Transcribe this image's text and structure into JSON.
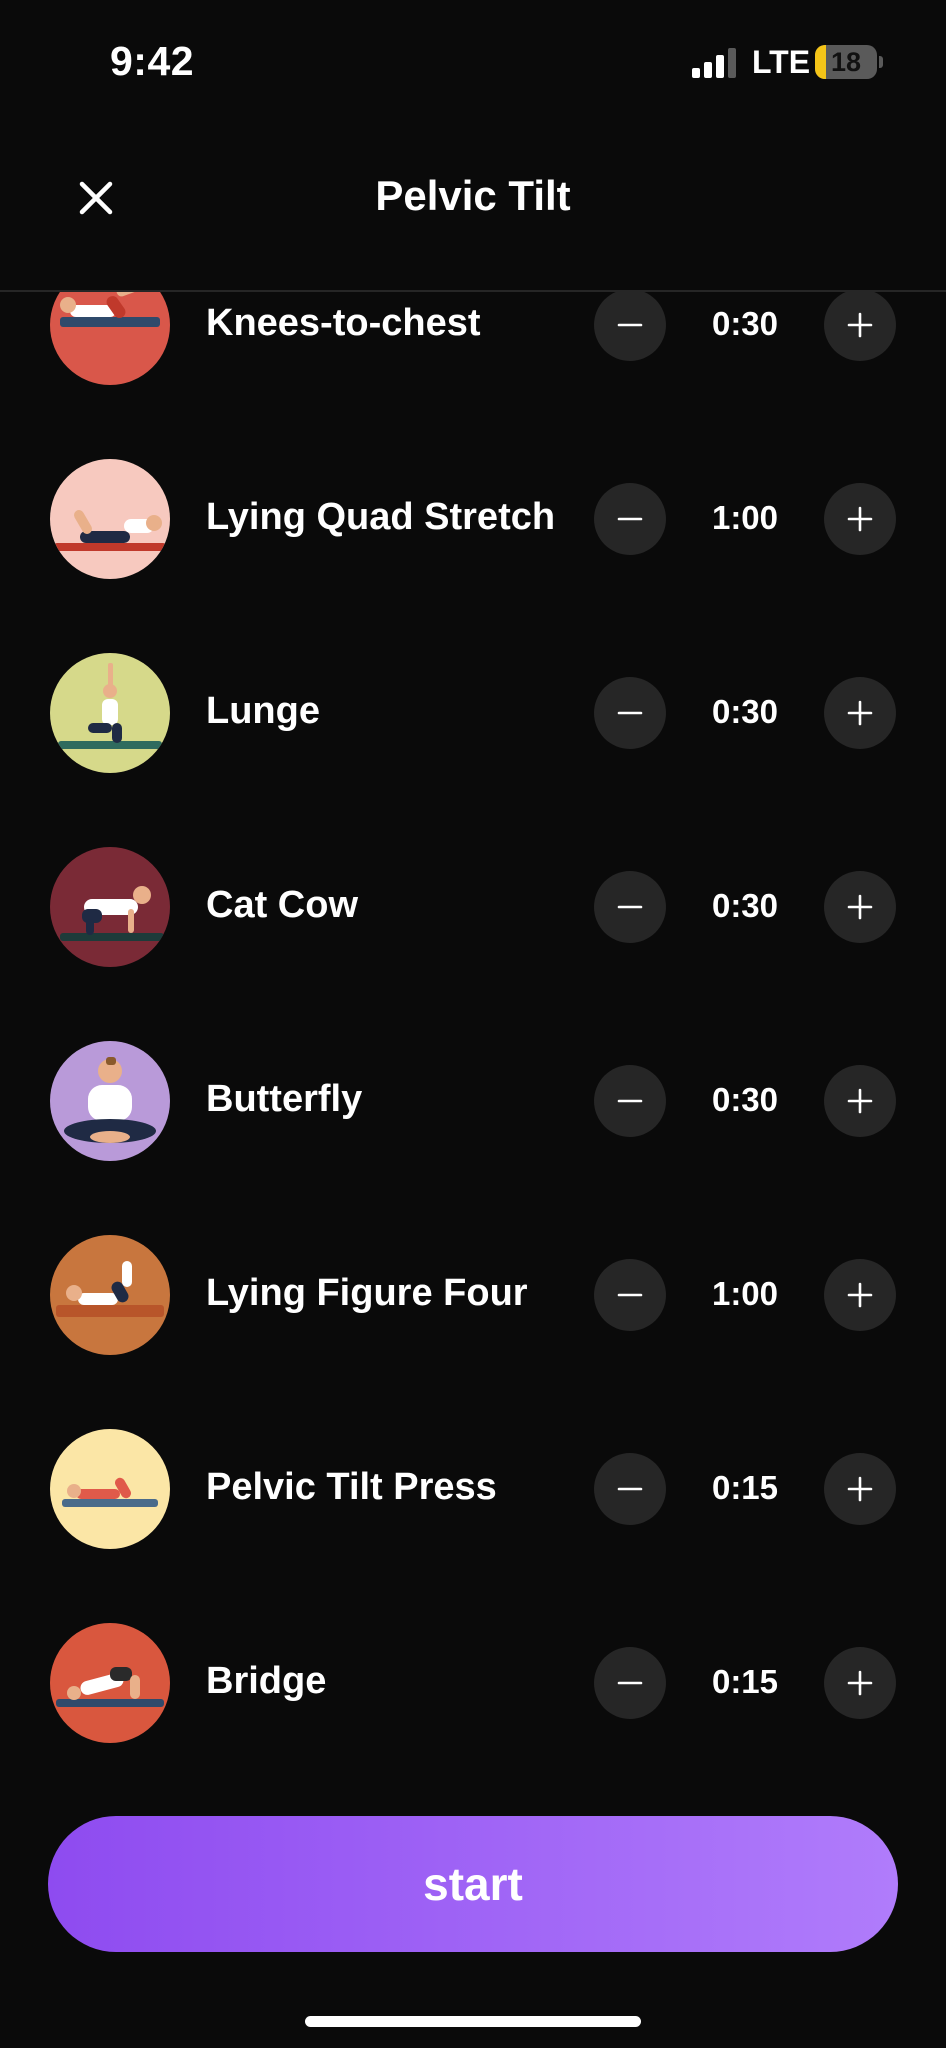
{
  "status_bar": {
    "time": "9:42",
    "network": "LTE",
    "battery_level": "18",
    "battery_fraction": 0.18,
    "signal_bars_active": 3,
    "battery_color": "#f5c518"
  },
  "header": {
    "title": "Pelvic Tilt",
    "close_icon": "close-icon"
  },
  "exercises": [
    {
      "name": "Knees-to-chest",
      "duration": "0:30",
      "avatar_bg": "#d9574a"
    },
    {
      "name": "Lying Quad Stretch",
      "duration": "1:00",
      "avatar_bg": "#f7c9bf"
    },
    {
      "name": "Lunge",
      "duration": "0:30",
      "avatar_bg": "#d6d98a"
    },
    {
      "name": "Cat Cow",
      "duration": "0:30",
      "avatar_bg": "#7a2a36"
    },
    {
      "name": "Butterfly",
      "duration": "0:30",
      "avatar_bg": "#b99ad9"
    },
    {
      "name": "Lying Figure Four",
      "duration": "1:00",
      "avatar_bg": "#c8763e"
    },
    {
      "name": "Pelvic Tilt Press",
      "duration": "0:15",
      "avatar_bg": "#fbe6a6"
    },
    {
      "name": "Bridge",
      "duration": "0:15",
      "avatar_bg": "#d9573e"
    }
  ],
  "controls": {
    "decrease_icon": "minus-icon",
    "increase_icon": "plus-icon"
  },
  "start_button": {
    "label": "start",
    "gradient_start": "#8e4bf0",
    "gradient_end": "#b07cfb"
  }
}
